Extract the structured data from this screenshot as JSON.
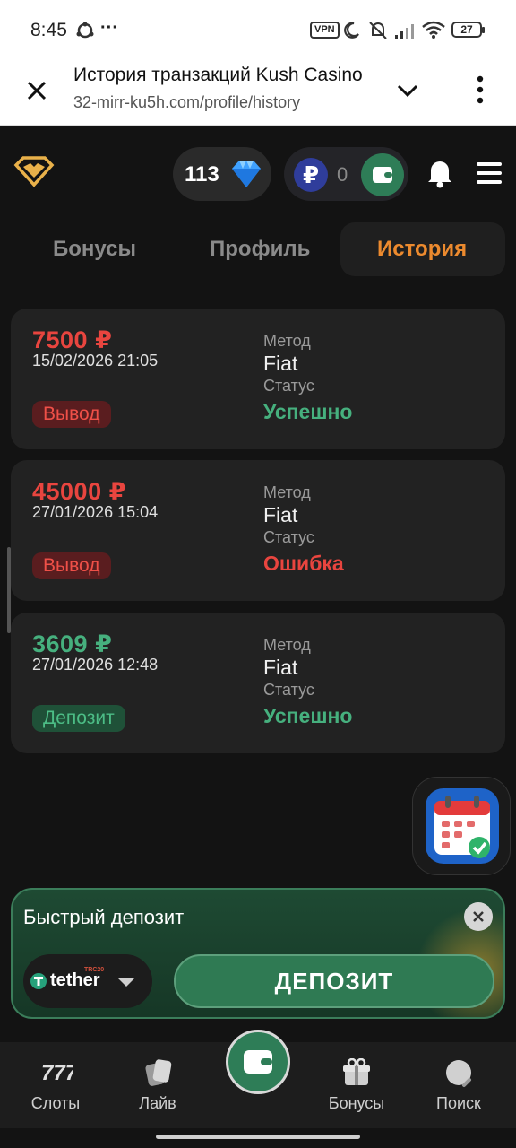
{
  "status_bar": {
    "time": "8:45",
    "extra": "···",
    "vpn": "VPN",
    "battery": "27"
  },
  "browser": {
    "title": "История транзакций Kush Casino",
    "url": "32-mirr-ku5h.com/profile/history"
  },
  "header": {
    "gems": "113",
    "balance_currency_symbol": "₽",
    "balance": "0"
  },
  "tabs": [
    {
      "label": "Бонусы",
      "active": false
    },
    {
      "label": "Профиль",
      "active": false
    },
    {
      "label": "История",
      "active": true
    }
  ],
  "transactions": [
    {
      "amount": "7500 ₽",
      "date": "15/02/2026 21:05",
      "type": "Вывод",
      "method_label": "Метод",
      "method": "Fiat",
      "status_label": "Статус",
      "status": "Успешно"
    },
    {
      "amount": "45000 ₽",
      "date": "27/01/2026 15:04",
      "type": "Вывод",
      "method_label": "Метод",
      "method": "Fiat",
      "status_label": "Статус",
      "status": "Ошибка"
    },
    {
      "amount": "3609 ₽",
      "date": "27/01/2026 12:48",
      "type": "Депозит",
      "method_label": "Метод",
      "method": "Fiat",
      "status_label": "Статус",
      "status": "Успешно"
    }
  ],
  "quick_deposit": {
    "title": "Быстрый депозит",
    "token": "tether",
    "token_network": "TRC20",
    "button": "ДЕПОЗИТ"
  },
  "bottom_nav": [
    {
      "label": "Слоты",
      "icon": "slots-777-icon"
    },
    {
      "label": "Лайв",
      "icon": "cards-icon"
    },
    {
      "label": "",
      "icon": "wallet-icon"
    },
    {
      "label": "Бонусы",
      "icon": "gift-icon"
    },
    {
      "label": "Поиск",
      "icon": "search-icon"
    }
  ],
  "colors": {
    "accent_orange": "#ec8a2e",
    "success_green": "#46b07e",
    "error_red": "#e9453f",
    "brand_green": "#2e7d57"
  }
}
